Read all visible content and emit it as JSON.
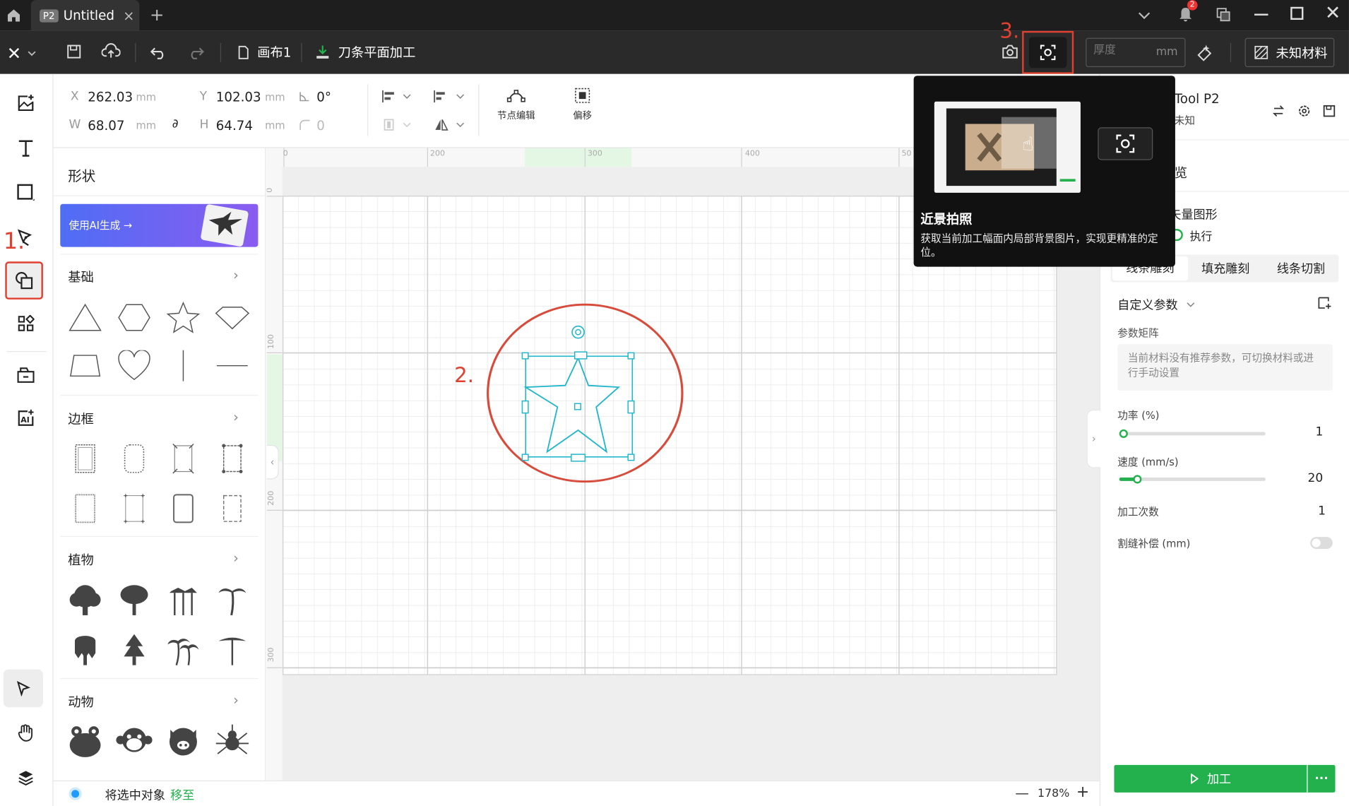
{
  "titlebar": {
    "tab_badge": "P2",
    "tab_title": "Untitled",
    "notification_count": "2"
  },
  "toolbar": {
    "canvas_label": "画布1",
    "mode_label": "刀条平面加工",
    "thickness_placeholder": "厚度",
    "thickness_unit": "mm",
    "material_label": "未知材料"
  },
  "props": {
    "x_label": "X",
    "x_value": "262.03",
    "y_label": "Y",
    "y_value": "102.03",
    "w_label": "W",
    "w_value": "68.07",
    "h_label": "H",
    "h_value": "64.74",
    "unit": "mm",
    "angle_value": "0°",
    "radius_value": "0",
    "node_edit_label": "节点编辑",
    "offset_label": "偏移"
  },
  "library": {
    "title": "形状",
    "ai_banner": "使用AI生成 →",
    "sections": [
      "基础",
      "边框",
      "植物",
      "动物"
    ]
  },
  "canvas": {
    "ruler_x": [
      "0",
      "200",
      "300",
      "400",
      "50"
    ],
    "ruler_y": [
      "0",
      "100",
      "200",
      "300"
    ]
  },
  "annotations": {
    "step1": "1.",
    "step2": "2.",
    "step3": "3."
  },
  "tooltip": {
    "title": "近景拍照",
    "desc": "获取当前加工幅面内局部背景图片，实现更精准的定位。"
  },
  "rpanel": {
    "device_name": "Tool P2",
    "device_status": "未知",
    "preview_label": "览",
    "vector_label": "矢量图形",
    "execute_label": "执行",
    "tabs": [
      "线条雕刻",
      "填充雕刻",
      "线条切割"
    ],
    "custom_params": "自定义参数",
    "param_matrix": "参数矩阵",
    "no_recommend": "当前材料没有推荐参数，可切换材料或进行手动设置",
    "power_label": "功率 (%)",
    "power_value": "1",
    "power_fraction": 0.0,
    "speed_label": "速度 (mm/s)",
    "speed_value": "20",
    "speed_fraction": 0.1,
    "passes_label": "加工次数",
    "passes_value": "1",
    "kerf_label": "割缝补偿 (mm)",
    "process_button": "加工",
    "more_button": "···"
  },
  "status": {
    "text": "将选中对象",
    "link": "移至",
    "zoom": "178%",
    "minus": "—",
    "plus": "+"
  },
  "colors": {
    "accent": "#22b14c",
    "annotation_red": "#e04030",
    "selection": "#1fb6cc"
  }
}
